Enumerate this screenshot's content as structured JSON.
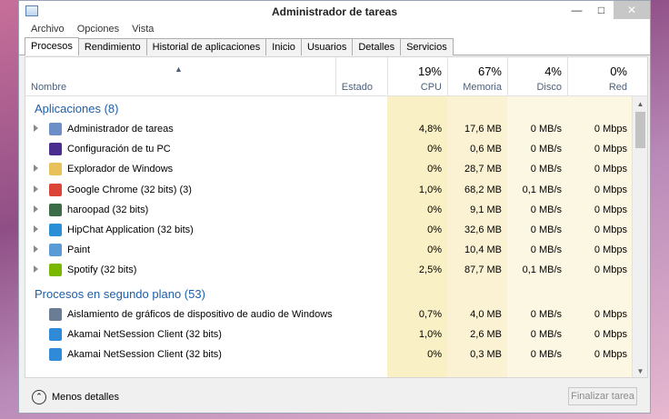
{
  "window": {
    "title": "Administrador de tareas"
  },
  "menu": [
    "Archivo",
    "Opciones",
    "Vista"
  ],
  "tabs": [
    "Procesos",
    "Rendimiento",
    "Historial de aplicaciones",
    "Inicio",
    "Usuarios",
    "Detalles",
    "Servicios"
  ],
  "columns": {
    "name": "Nombre",
    "status": "Estado",
    "cpu": {
      "label": "CPU",
      "pct": "19%"
    },
    "memory": {
      "label": "Memoria",
      "pct": "67%"
    },
    "disk": {
      "label": "Disco",
      "pct": "4%"
    },
    "network": {
      "label": "Red",
      "pct": "0%"
    }
  },
  "groups": {
    "apps": {
      "title": "Aplicaciones (8)",
      "rows": [
        {
          "name": "Administrador de tareas",
          "cpu": "4,8%",
          "mem": "17,6 MB",
          "disk": "0 MB/s",
          "net": "0 Mbps",
          "icon": "task-manager-icon",
          "color": "#6d8fc7",
          "expandable": true
        },
        {
          "name": "Configuración de tu PC",
          "cpu": "0%",
          "mem": "0,6 MB",
          "disk": "0 MB/s",
          "net": "0 Mbps",
          "icon": "settings-icon",
          "color": "#4a2d8c",
          "expandable": false
        },
        {
          "name": "Explorador de Windows",
          "cpu": "0%",
          "mem": "28,7 MB",
          "disk": "0 MB/s",
          "net": "0 Mbps",
          "icon": "explorer-icon",
          "color": "#e8c15a",
          "expandable": true
        },
        {
          "name": "Google Chrome (32 bits) (3)",
          "cpu": "1,0%",
          "mem": "68,2 MB",
          "disk": "0,1 MB/s",
          "net": "0 Mbps",
          "icon": "chrome-icon",
          "color": "#db4437",
          "expandable": true
        },
        {
          "name": "haroopad (32 bits)",
          "cpu": "0%",
          "mem": "9,1 MB",
          "disk": "0 MB/s",
          "net": "0 Mbps",
          "icon": "haroopad-icon",
          "color": "#3c6b47",
          "expandable": true
        },
        {
          "name": "HipChat Application (32 bits)",
          "cpu": "0%",
          "mem": "32,6 MB",
          "disk": "0 MB/s",
          "net": "0 Mbps",
          "icon": "hipchat-icon",
          "color": "#2a8fd4",
          "expandable": true
        },
        {
          "name": "Paint",
          "cpu": "0%",
          "mem": "10,4 MB",
          "disk": "0 MB/s",
          "net": "0 Mbps",
          "icon": "paint-icon",
          "color": "#5b9bd5",
          "expandable": true
        },
        {
          "name": "Spotify (32 bits)",
          "cpu": "2,5%",
          "mem": "87,7 MB",
          "disk": "0,1 MB/s",
          "net": "0 Mbps",
          "icon": "spotify-icon",
          "color": "#7ab800",
          "expandable": true
        }
      ]
    },
    "background": {
      "title": "Procesos en segundo plano (53)",
      "rows": [
        {
          "name": "Aislamiento de gráficos de dispositivo de audio de Windows",
          "cpu": "0,7%",
          "mem": "4,0 MB",
          "disk": "0 MB/s",
          "net": "0 Mbps",
          "icon": "audio-isolation-icon",
          "color": "#6a7d95",
          "expandable": false
        },
        {
          "name": "Akamai NetSession Client (32 bits)",
          "cpu": "1,0%",
          "mem": "2,6 MB",
          "disk": "0 MB/s",
          "net": "0 Mbps",
          "icon": "akamai-icon",
          "color": "#2f8ad8",
          "expandable": false
        },
        {
          "name": "Akamai NetSession Client (32 bits)",
          "cpu": "0%",
          "mem": "0,3 MB",
          "disk": "0 MB/s",
          "net": "0 Mbps",
          "icon": "akamai-icon",
          "color": "#2f8ad8",
          "expandable": false
        }
      ]
    }
  },
  "footer": {
    "less_details": "Menos detalles",
    "end_task": "Finalizar tarea"
  },
  "colors": {
    "cpu_bg": "#f9f0c5",
    "cpu_bg_hot": "#f5e6a8",
    "mem_bg": "#faf1cd",
    "other_bg": "#fbf6dd",
    "group_title": "#1d5fa8"
  }
}
